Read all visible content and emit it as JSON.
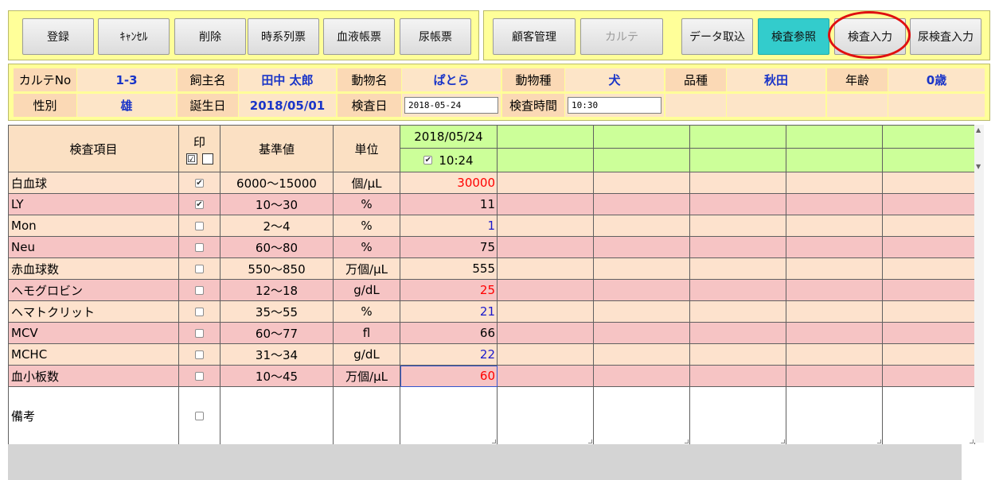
{
  "toolbar": {
    "left": [
      "登録",
      "ｷｬﾝｾﾙ",
      "削除",
      "時系列票",
      "血液帳票",
      "尿帳票"
    ],
    "customer": "顧客管理",
    "karte": "カルテ",
    "import": "データ取込",
    "ref": "検査参照",
    "input": "検査入力",
    "urine_input": "尿検査入力"
  },
  "info": {
    "karte_no_label": "カルテNo",
    "karte_no": "1-3",
    "owner_label": "飼主名",
    "owner": "田中 太郎",
    "animal_label": "動物名",
    "animal": "ぱとら",
    "species_label": "動物種",
    "species": "犬",
    "breed_label": "品種",
    "breed": "秋田",
    "age_label": "年齢",
    "age": "0歳",
    "sex_label": "性別",
    "sex": "雄",
    "birth_label": "誕生日",
    "birth": "2018/05/01",
    "exam_date_label": "検査日",
    "exam_date": "2018-05-24",
    "exam_time_label": "検査時間",
    "exam_time": "10:30"
  },
  "grid": {
    "col_item": "検査項目",
    "col_print": "印",
    "col_ref": "基準値",
    "col_unit": "単位",
    "result_date": "2018/05/24",
    "result_time": "10:24",
    "remarks_label": "備考",
    "rows": [
      {
        "name": "白血球",
        "checked": true,
        "ref": "6000～15000",
        "unit": "個/µL",
        "value": "30000",
        "color": "#ff0000"
      },
      {
        "name": "LY",
        "checked": true,
        "ref": "10～30",
        "unit": "%",
        "value": "11",
        "color": "#000000"
      },
      {
        "name": "Mon",
        "checked": false,
        "ref": "2～4",
        "unit": "%",
        "value": "1",
        "color": "#1a1acc"
      },
      {
        "name": "Neu",
        "checked": false,
        "ref": "60～80",
        "unit": "%",
        "value": "75",
        "color": "#000000"
      },
      {
        "name": "赤血球数",
        "checked": false,
        "ref": "550～850",
        "unit": "万個/µL",
        "value": "555",
        "color": "#000000"
      },
      {
        "name": "ヘモグロビン",
        "checked": false,
        "ref": "12～18",
        "unit": "g/dL",
        "value": "25",
        "color": "#ff0000"
      },
      {
        "name": "ヘマトクリット",
        "checked": false,
        "ref": "35～55",
        "unit": "%",
        "value": "21",
        "color": "#1a1acc"
      },
      {
        "name": "MCV",
        "checked": false,
        "ref": "60～77",
        "unit": "fl",
        "value": "66",
        "color": "#000000"
      },
      {
        "name": "MCHC",
        "checked": false,
        "ref": "31～34",
        "unit": "g/dL",
        "value": "22",
        "color": "#1a1acc"
      },
      {
        "name": "血小板数",
        "checked": false,
        "ref": "10～45",
        "unit": "万個/µL",
        "value": "60",
        "color": "#ff0000"
      }
    ]
  }
}
